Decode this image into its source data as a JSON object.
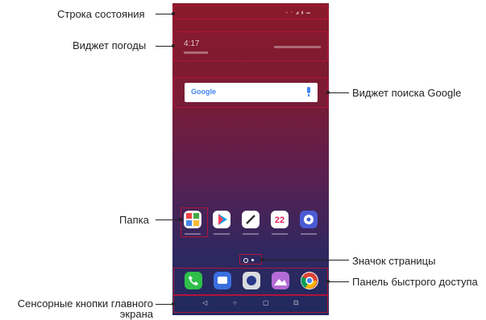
{
  "callouts": {
    "status_bar": "Строка состояния",
    "weather_widget": "Виджет погоды",
    "google_search_widget": "Виджет поиска Google",
    "folder": "Папка",
    "page_indicator": "Значок страницы",
    "quick_access_panel": "Панель быстрого доступа",
    "home_touch_buttons_line1": "Сенсорные кнопки главного",
    "home_touch_buttons_line2": "экрана"
  },
  "phone": {
    "weather_time": "4:17",
    "search_logo": "Google",
    "apps": [
      {
        "icon": "folder-icon",
        "color": "#ffffff"
      },
      {
        "icon": "play-store-icon",
        "color": "#ffffff"
      },
      {
        "icon": "pen-icon",
        "color": "#ffffff"
      },
      {
        "icon": "calendar-icon",
        "color": "#ffffff",
        "text": "22"
      },
      {
        "icon": "settings-icon",
        "color": "#4a5bd4"
      }
    ],
    "dock": [
      {
        "icon": "phone-icon",
        "color": "#2fbf4a"
      },
      {
        "icon": "messages-icon",
        "color": "#3b6fe0"
      },
      {
        "icon": "camera-icon",
        "color": "#d9dbe0"
      },
      {
        "icon": "gallery-icon",
        "color": "#b56bd6"
      },
      {
        "icon": "chrome-icon",
        "color": "#ffffff"
      }
    ]
  },
  "colors": {
    "highlight": "#b0143a"
  }
}
